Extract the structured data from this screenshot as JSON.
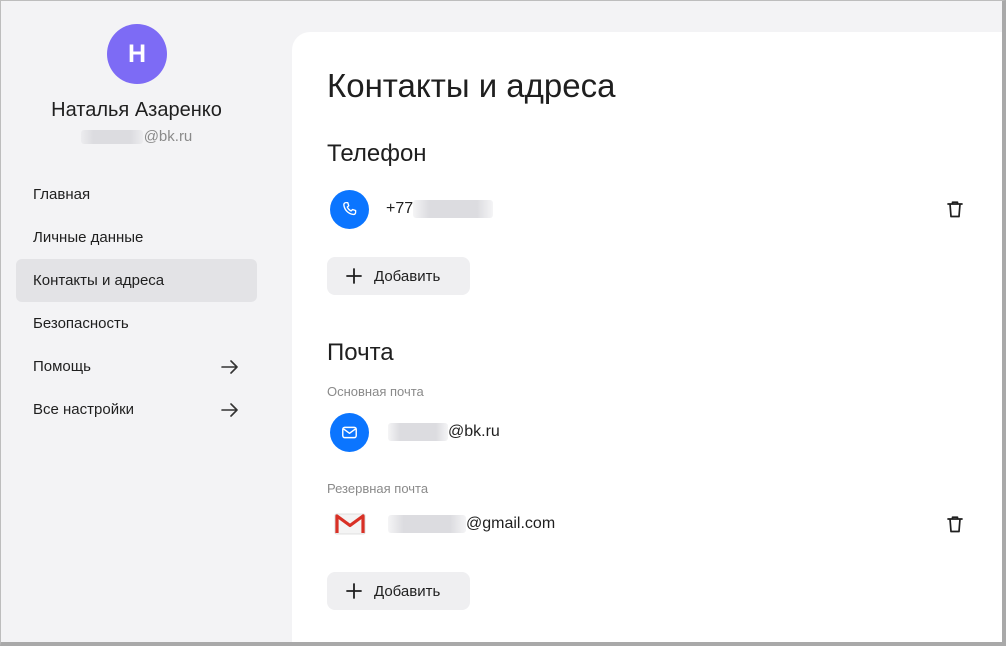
{
  "user": {
    "initial": "Н",
    "name": "Наталья Азаренко",
    "email_suffix": "@bk.ru",
    "avatar_color": "#7d6bf5"
  },
  "sidebar": {
    "items": [
      {
        "label": "Главная",
        "active": false,
        "arrow": false
      },
      {
        "label": "Личные данные",
        "active": false,
        "arrow": false
      },
      {
        "label": "Контакты и адреса",
        "active": true,
        "arrow": false
      },
      {
        "label": "Безопасность",
        "active": false,
        "arrow": false
      },
      {
        "label": "Помощь",
        "active": false,
        "arrow": true,
        "icon": "arrow-right-icon"
      },
      {
        "label": "Все настройки",
        "active": false,
        "arrow": true,
        "icon": "arrow-right-icon"
      }
    ]
  },
  "main": {
    "title": "Контакты и адреса",
    "phone_section": {
      "title": "Телефон",
      "number_prefix": "+7",
      "number_visible": "7",
      "icon": "phone-icon",
      "delete_icon": "trash-icon",
      "add_label": "Добавить"
    },
    "mail_section": {
      "title": "Почта",
      "primary_label": "Основная почта",
      "primary_suffix": "@bk.ru",
      "primary_icon": "mail-icon",
      "backup_label": "Резервная почта",
      "backup_suffix": "@gmail.com",
      "backup_icon": "gmail-icon",
      "delete_icon": "trash-icon",
      "add_label": "Добавить"
    }
  },
  "colors": {
    "accent_blue": "#0b75ff",
    "active_nav": "#e3e3e6",
    "button_bg": "#efeff1"
  }
}
